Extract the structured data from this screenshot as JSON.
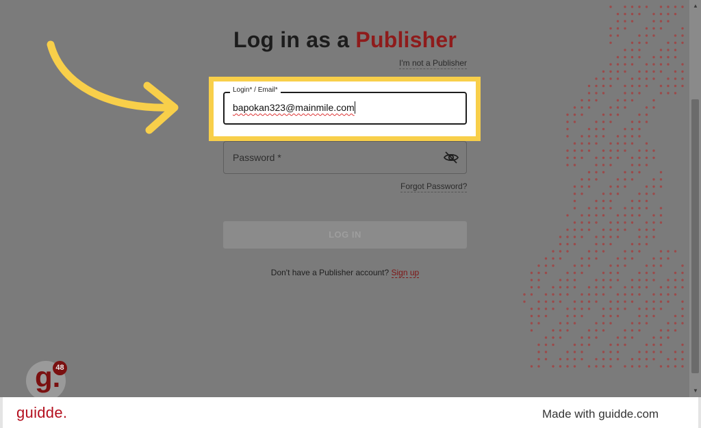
{
  "title": {
    "prefix": "Log in as a ",
    "accent": "Publisher"
  },
  "not_publisher_link": "I'm not a Publisher",
  "email_field": {
    "label": "Login* / Email*",
    "value": "bapokan323@mainmile.com"
  },
  "password_field": {
    "label": "Password *"
  },
  "forgot_password_link": "Forgot Password?",
  "login_button": "LOG IN",
  "signup": {
    "prompt": "Don't have a Publisher account? ",
    "link": "Sign up"
  },
  "badge": {
    "letter": "g.",
    "count": "48"
  },
  "footer": {
    "logo": "guidde.",
    "made_with": "Made with guidde.com"
  },
  "colors": {
    "accent": "#8e1b1b",
    "highlight": "#f8cf4a",
    "brand": "#b40f1e",
    "overlay_bg": "#7b7b7b"
  },
  "icons": {
    "eye": "eye-off-icon",
    "arrow": "curved-arrow-icon"
  }
}
